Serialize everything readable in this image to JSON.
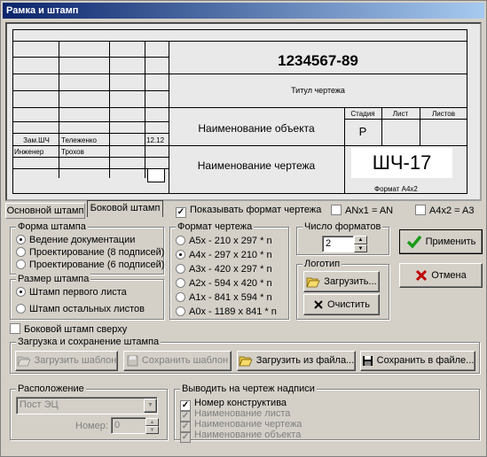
{
  "window": {
    "title": "Рамка и штамп"
  },
  "stamp": {
    "doc_number": "1234567-89",
    "drawing_title": "Титул чертежа",
    "object_name": "Наименование объекта",
    "drawing_name": "Наименование чертежа",
    "stage_header": "Стадия",
    "sheet_header": "Лист",
    "sheets_header": "Листов",
    "stage_value": "Р",
    "code": "ШЧ-17",
    "format_label": "Формат А4х2",
    "rows": [
      {
        "role": "Зам.ШЧ",
        "name": "Тележенко",
        "date": "12.12"
      },
      {
        "role": "Инженер",
        "name": "Трохов",
        "date": ""
      }
    ]
  },
  "tabs": [
    {
      "label": "Основной штамп"
    },
    {
      "label": "Боковой штамп"
    }
  ],
  "options": {
    "show_format": "Показывать формат чертежа",
    "show_format_checked": true,
    "anx1": "ANx1 = AN",
    "anx1_checked": false,
    "a4x2": "A4x2 = A3",
    "a4x2_checked": false
  },
  "stamp_form": {
    "title": "Форма штампа",
    "items": [
      "Ведение документации",
      "Проектирование (8 подписей)",
      "Проектирование (6 подписей)"
    ],
    "selected": 0
  },
  "stamp_size": {
    "title": "Размер штампа",
    "items": [
      "Штамп первого листа",
      "Штамп остальных листов"
    ],
    "selected": 0
  },
  "side_stamp_top": {
    "label": "Боковой штамп сверху",
    "checked": false
  },
  "drawing_format": {
    "title": "Формат чертежа",
    "items": [
      "А5х -  210 х 297 * n",
      "А4х -  297 х 210 * n",
      "А3х -  420 х 297 * n",
      "А2х -  594 х 420 * n",
      "А1х -  841 х 594 * n",
      "А0х - 1189 х 841 * n"
    ],
    "selected": 1
  },
  "format_count": {
    "title": "Число форматов",
    "value": "2"
  },
  "logo": {
    "title": "Логотип",
    "load": "Загрузить...",
    "clear": "Очистить"
  },
  "actions": {
    "apply": "Применить",
    "cancel": "Отмена"
  },
  "load_save": {
    "title": "Загрузка и сохранение штампа",
    "load_template": "Загрузить шаблон",
    "save_template": "Сохранить шаблон",
    "load_file": "Загрузить из файла...",
    "save_file": "Сохранить в файле..."
  },
  "location": {
    "title": "Расположение",
    "value": "Пост ЭЦ",
    "number_label": "Номер:",
    "number_value": "0"
  },
  "inscriptions": {
    "title": "Выводить на чертеж надписи",
    "items": [
      {
        "label": "Номер конструктива",
        "checked": true,
        "enabled": true
      },
      {
        "label": "Наименование листа",
        "checked": true,
        "enabled": false
      },
      {
        "label": "Наименование чертежа",
        "checked": true,
        "enabled": false
      },
      {
        "label": "Наименование объекта",
        "checked": true,
        "enabled": false
      }
    ]
  },
  "colors": {
    "title_start": "#0a246a",
    "title_end": "#a6caf0",
    "face": "#d4d0c8",
    "apply_icon": "#1a9a1a",
    "cancel_icon": "#c00000"
  }
}
